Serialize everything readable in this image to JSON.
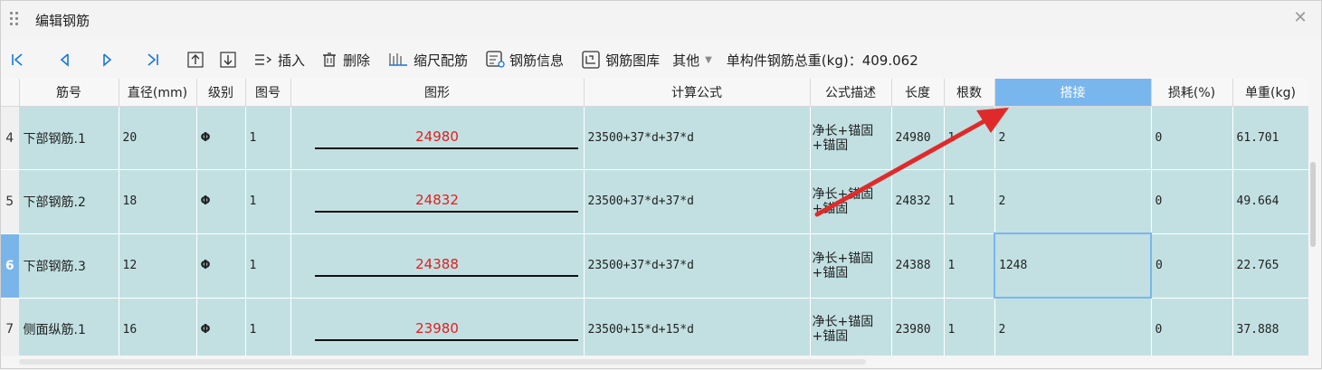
{
  "window": {
    "title": "编辑钢筋"
  },
  "toolbar": {
    "insert_label": "插入",
    "delete_label": "删除",
    "scale_label": "缩尺配筋",
    "info_label": "钢筋信息",
    "library_label": "钢筋图库",
    "other_label": "其他",
    "total_label": "单构件钢筋总重(kg)：409.062"
  },
  "columns": [
    "筋号",
    "直径(mm)",
    "级别",
    "图号",
    "图形",
    "计算公式",
    "公式描述",
    "长度",
    "根数",
    "搭接",
    "损耗(%)",
    "单重(kg)"
  ],
  "rows": [
    {
      "num": "4",
      "name": "下部钢筋.1",
      "dia": "20",
      "grade": "Φ",
      "fig": "1",
      "shape_len": "24980",
      "formula": "23500+37*d+37*d",
      "desc": "净长+锚固+锚固",
      "length": "24980",
      "count": "1",
      "lap": "2",
      "loss": "0",
      "weight": "61.701"
    },
    {
      "num": "5",
      "name": "下部钢筋.2",
      "dia": "18",
      "grade": "Φ",
      "fig": "1",
      "shape_len": "24832",
      "formula": "23500+37*d+37*d",
      "desc": "净长+锚固+锚固",
      "length": "24832",
      "count": "1",
      "lap": "2",
      "loss": "0",
      "weight": "49.664"
    },
    {
      "num": "6",
      "name": "下部钢筋.3",
      "dia": "12",
      "grade": "Φ",
      "fig": "1",
      "shape_len": "24388",
      "formula": "23500+37*d+37*d",
      "desc": "净长+锚固+锚固",
      "length": "24388",
      "count": "1",
      "lap": "1248",
      "loss": "0",
      "weight": "22.765"
    },
    {
      "num": "7",
      "name": "侧面纵筋.1",
      "dia": "16",
      "grade": "Φ",
      "fig": "1",
      "shape_len": "23980",
      "formula": "23500+15*d+15*d",
      "desc": "净长+锚固+锚固",
      "length": "23980",
      "count": "1",
      "lap": "2",
      "loss": "0",
      "weight": "37.888"
    }
  ],
  "colors": {
    "row_bg": "#c2e0e2",
    "header_selected": "#79b6ee",
    "shape_text": "#e02020",
    "annotation_arrow": "#e02a2a"
  }
}
